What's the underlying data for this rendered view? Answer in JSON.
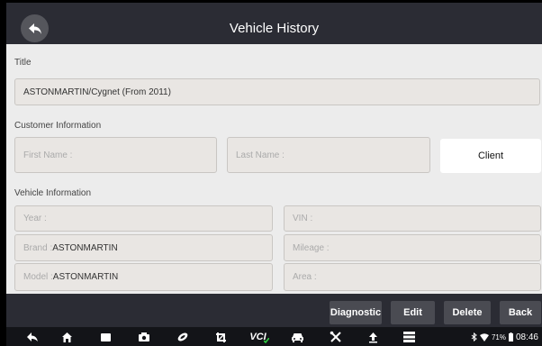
{
  "header": {
    "title": "Vehicle History"
  },
  "title_section": {
    "label": "Title",
    "value": "ASTONMARTIN/Cygnet (From 2011)"
  },
  "customer": {
    "label": "Customer Information",
    "first_name_label": "First Name :",
    "last_name_label": "Last Name :",
    "client_button": "Client"
  },
  "vehicle": {
    "label": "Vehicle Information",
    "year_label": "Year :",
    "brand_label": "Brand : ",
    "brand_value": "ASTONMARTIN",
    "model_label": "Model : ",
    "model_value": "ASTONMARTIN",
    "vin_label": "VIN :",
    "mileage_label": "Mileage :",
    "area_label": "Area :"
  },
  "actions": {
    "diagnostic": "Diagnostic",
    "edit": "Edit",
    "delete": "Delete",
    "back": "Back"
  },
  "nav": {
    "vci_label": "VCI"
  },
  "status": {
    "battery": "71%",
    "time": "08:46"
  },
  "colors": {
    "header_bg": "#2b2c34",
    "content_bg": "#ececec",
    "field_bg": "#e9e6e3",
    "nav_bg": "#131418",
    "vci_accent": "#2ecc40"
  },
  "icons": [
    "back-arrow-icon",
    "home-icon",
    "recent-apps-icon",
    "camera-icon",
    "browser-icon",
    "crop-icon",
    "vci-icon",
    "car-icon",
    "tools-icon",
    "upload-icon",
    "menu-icon",
    "bluetooth-icon",
    "wifi-icon",
    "battery-icon"
  ]
}
